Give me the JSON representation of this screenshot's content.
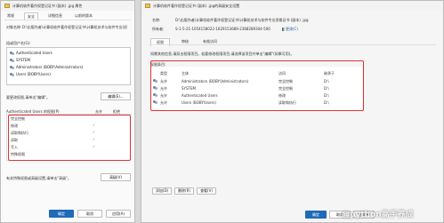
{
  "left_window": {
    "title": "计算机软件著作权登记证书 (副本) .jpg 属性",
    "tabs": [
      "常规",
      "安全",
      "详细信息",
      "以前的版本"
    ],
    "object_name_label": "对象名称:",
    "object_name_value": "D:\\出版作者\\计算机软件著作权登记证书\\计算机技术与软件专业(初",
    "group_label": "组或用户名(G):",
    "users": [
      "Authenticated Users",
      "SYSTEM",
      "Administrators (BOBY\\Administrators)",
      "Users (BOBY\\Users)"
    ],
    "edit_hint": "要更改权限,请单击\"编辑\"。",
    "edit_button": "编辑(E)...",
    "perm_label": "Authenticated Users 的权限(P)",
    "allow_label": "允许",
    "deny_label": "拒绝",
    "perms": [
      "完全控制",
      "修改",
      "读取和执行",
      "读取",
      "写入",
      "特殊权限"
    ],
    "special_hint": "有关特殊权限或高级设置,请单击\"高级\"。",
    "advanced_button": "高级(V)",
    "ok": "确定",
    "cancel": "取消",
    "apply": "应用(A)"
  },
  "right_window": {
    "title": "计算机软件著作权登记证书 (副本) .jpg的高级安全设置",
    "name_label": "名称:",
    "name_value": "D:\\出版作者\\计算机软件著作权登记证书\\计算机技术与软件专业资格证书 (副本) .jpg",
    "owner_label": "所有者:",
    "owner_value": "S-1-5-21-1054158022-1629153689-2368289304-500",
    "change_link": "更改(C)",
    "tabs": [
      "权限",
      "审核",
      "有效访问"
    ],
    "info_text": "如需其他信息,请双击权限项目。若要修改权限项目,请选择该项目并单击\"编辑\"(如果可用)。",
    "entries_label": "权限条目:",
    "columns": [
      "类型",
      "主体",
      "访问",
      "继承于"
    ],
    "rows": [
      {
        "type": "允许",
        "principal": "Administrators (BOBY\\Administrators)",
        "access": "完全控制",
        "inherit": "D:\\"
      },
      {
        "type": "允许",
        "principal": "SYSTEM",
        "access": "完全控制",
        "inherit": "D:\\"
      },
      {
        "type": "允许",
        "principal": "Authenticated Users",
        "access": "修改",
        "inherit": "D:\\"
      },
      {
        "type": "允许",
        "principal": "Users (BOBY\\Users)",
        "access": "读取和执行",
        "inherit": "D:\\"
      }
    ],
    "add_button": "添加(D)",
    "remove_button": "删除(R)",
    "view_button": "查看(V)",
    "ok": "确定",
    "cancel": "取消",
    "apply": "应用(A)"
  },
  "watermark": "@python高手养成"
}
